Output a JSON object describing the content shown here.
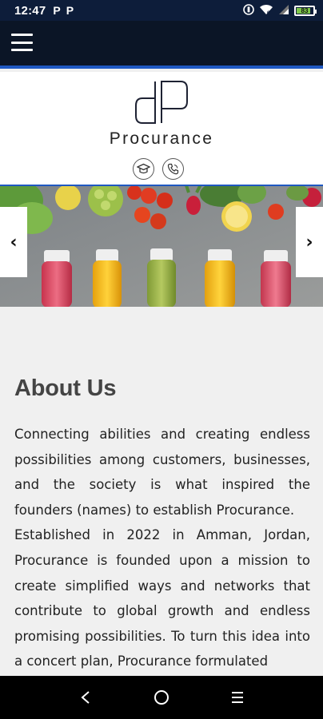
{
  "status_bar": {
    "time": "12:47",
    "notif_icons": [
      "P",
      "P"
    ],
    "battery_level": "83",
    "battery_fraction": 0.83
  },
  "header": {
    "menu_icon": "hamburger-icon",
    "accent_color": "#1f58c2",
    "bar_color": "#0b1526"
  },
  "logo": {
    "brand_text": "Procurance",
    "icons": [
      "graduation-cap-icon",
      "phone-icon"
    ]
  },
  "hero": {
    "prev_label": "‹",
    "next_label": "›"
  },
  "about": {
    "title": "About Us",
    "paragraph_1": "Connecting abilities and creating endless possibilities among customers, businesses, and the society is what inspired the founders (names) to establish Procurance.",
    "paragraph_2": "Established in 2022 in Amman, Jordan, Procurance is founded upon a mission to create simplified ways and networks that contribute to global growth and endless promising possibilities. To turn this idea into a concert plan, Procurance formulated"
  },
  "nav": {
    "icons": [
      "back-icon",
      "home-icon",
      "recents-icon"
    ]
  }
}
